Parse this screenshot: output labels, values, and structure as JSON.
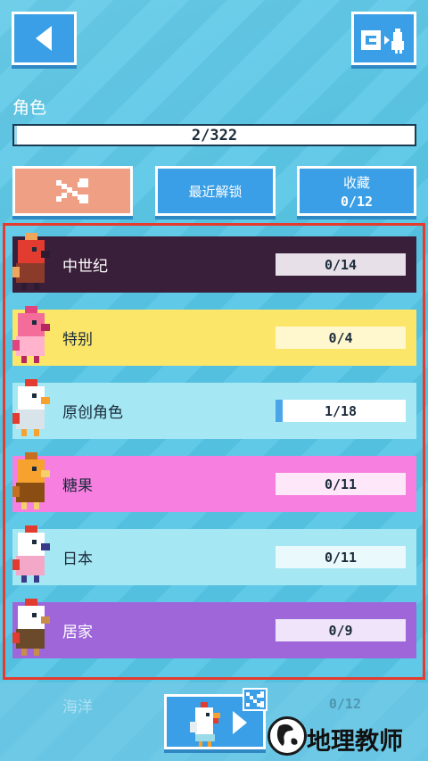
{
  "header": {
    "title": "角色",
    "progress_text": "2/322",
    "progress_fraction": 0.006
  },
  "tabs": {
    "shuffle_icon": "shuffle-icon",
    "recent_label": "最近解锁",
    "favorites_label": "收藏",
    "favorites_count": "0/12"
  },
  "categories": [
    {
      "name": "中世纪",
      "count": "0/14",
      "progress": 0,
      "bg": "#3a1f3a",
      "text": "#ffffff",
      "pill": "#e8e0e8"
    },
    {
      "name": "特别",
      "count": "0/4",
      "progress": 0,
      "bg": "#fce669",
      "text": "#1b2b3a",
      "pill": "#fff8cf"
    },
    {
      "name": "原创角色",
      "count": "1/18",
      "progress": 0.056,
      "bg": "#a6e7f4",
      "text": "#1b2b3a",
      "pill": "#ffffff"
    },
    {
      "name": "糖果",
      "count": "0/11",
      "progress": 0,
      "bg": "#f77fe0",
      "text": "#1b2b3a",
      "pill": "#fde7f9"
    },
    {
      "name": "日本",
      "count": "0/11",
      "progress": 0,
      "bg": "#a6e7f4",
      "text": "#1b2b3a",
      "pill": "#e9f9fc"
    },
    {
      "name": "居家",
      "count": "0/9",
      "progress": 0,
      "bg": "#9e66d8",
      "text": "#ffffff",
      "pill": "#efe4fa"
    }
  ],
  "hidden_row": {
    "name": "海洋",
    "count": "0/12"
  },
  "watermark": {
    "text": "地理教师"
  },
  "colors": {
    "accent_blue": "#3a9fe6",
    "highlight_red": "#e53b2f",
    "background": "#57c6e6"
  }
}
